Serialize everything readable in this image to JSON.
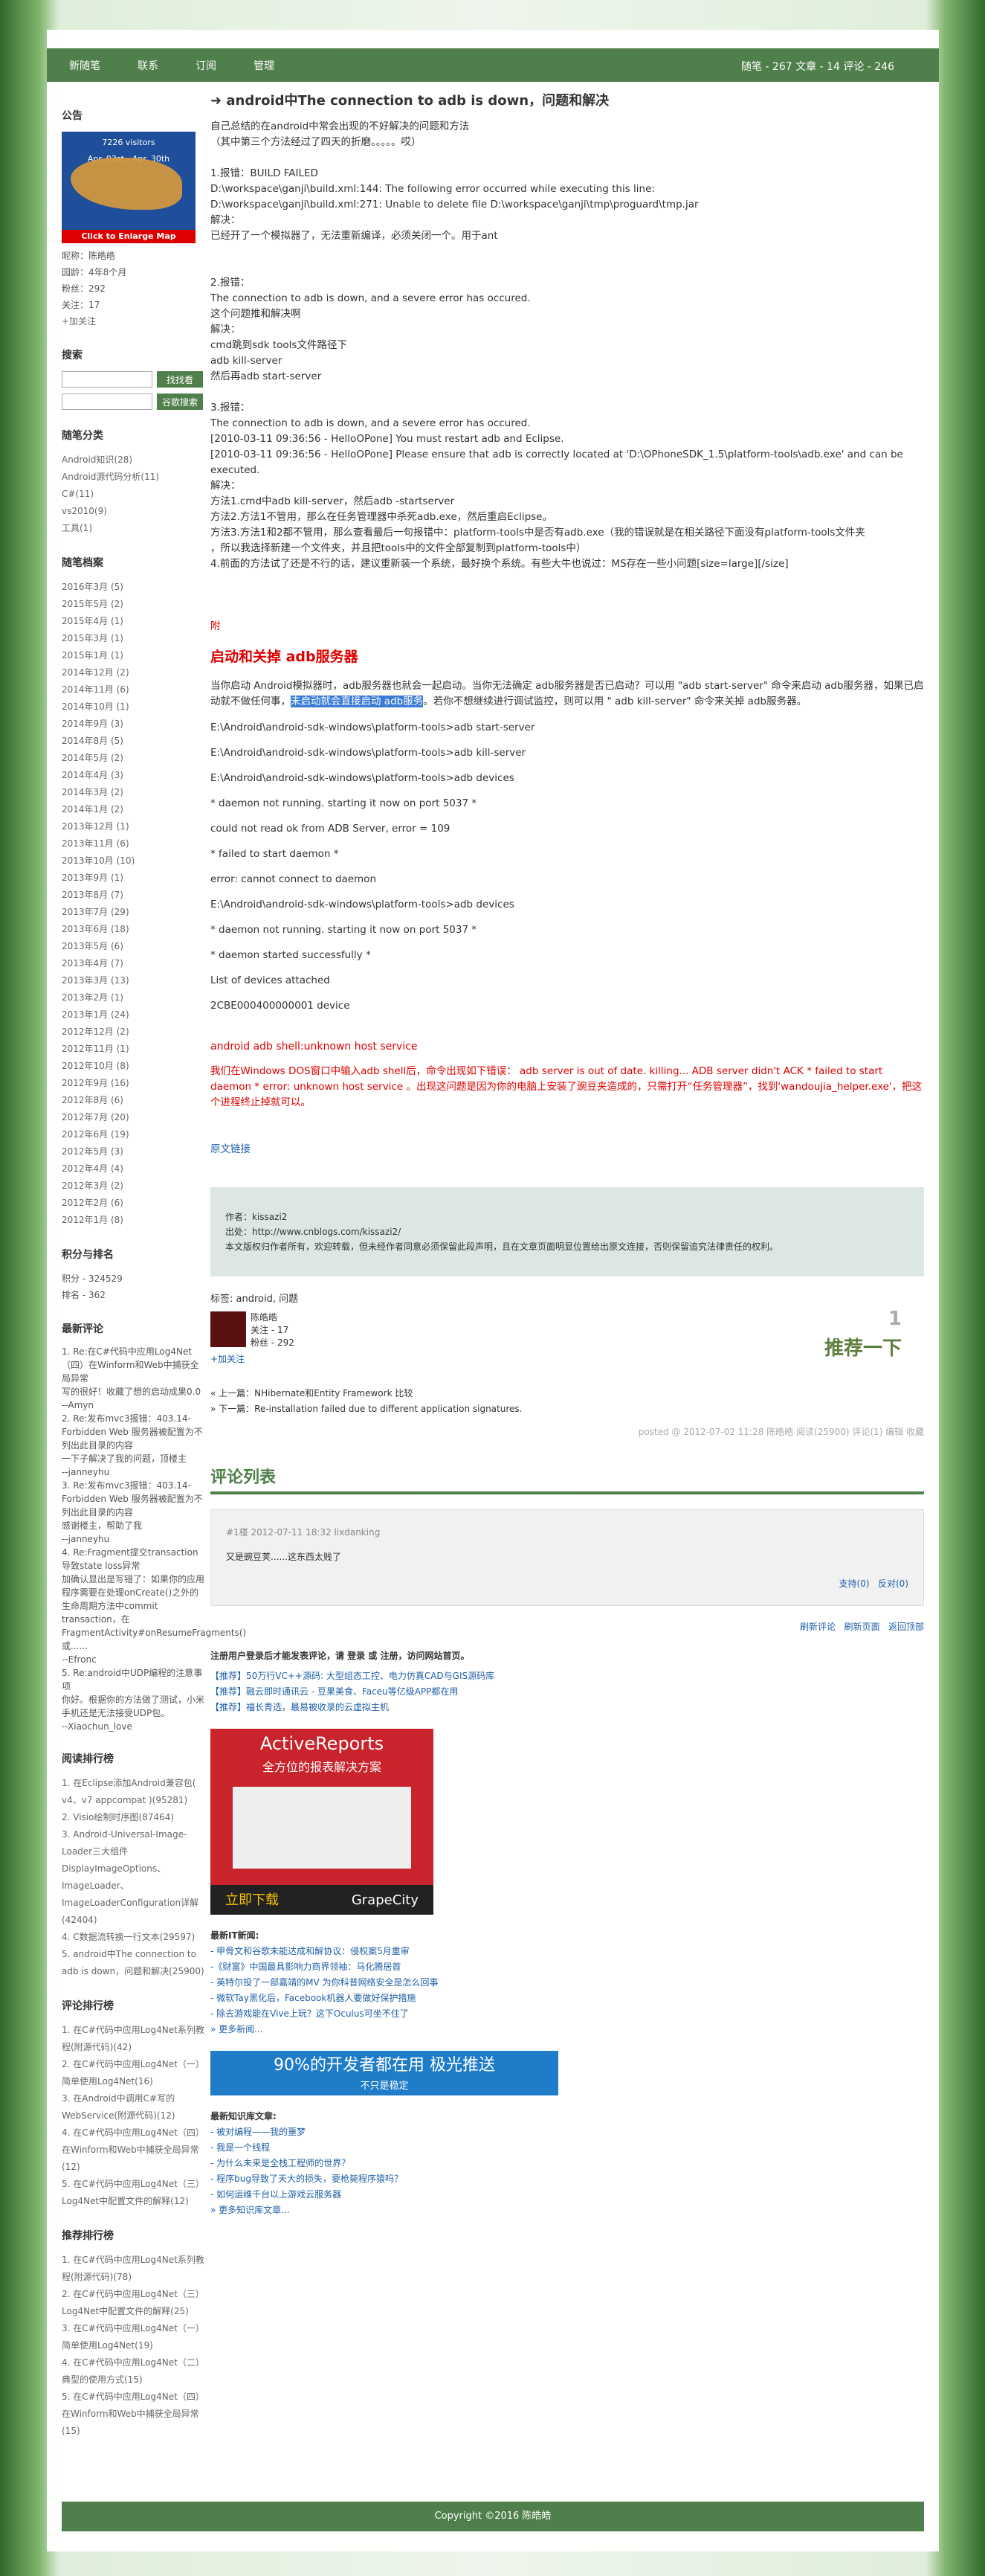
{
  "header": {
    "nav": [
      "新随笔",
      "联系",
      "订阅",
      "管理"
    ],
    "stats": "随笔 - 267  文章 - 14  评论 - 246"
  },
  "sidebar": {
    "notice_title": "公告",
    "map": {
      "caption1": "7226 visitors",
      "caption2": "Apr. 03st - Apr. 30th",
      "button": "Click to Enlarge Map"
    },
    "profile": [
      "昵称：陈皓皓",
      "园龄：4年8个月",
      "粉丝：292",
      "关注：17",
      "+加关注"
    ],
    "search_title": "搜索",
    "search_btn1": "找找看",
    "search_btn2": "谷歌搜索",
    "categories_title": "随笔分类",
    "categories": [
      "Android知识(28)",
      "Android源代码分析(11)",
      "C#(11)",
      "vs2010(9)",
      "工具(1)"
    ],
    "archive_title": "随笔档案",
    "archives": [
      "2016年3月 (5)",
      "2015年5月 (2)",
      "2015年4月 (1)",
      "2015年3月 (1)",
      "2015年1月 (1)",
      "2014年12月 (2)",
      "2014年11月 (6)",
      "2014年10月 (1)",
      "2014年9月 (3)",
      "2014年8月 (5)",
      "2014年5月 (2)",
      "2014年4月 (3)",
      "2014年3月 (2)",
      "2014年1月 (2)",
      "2013年12月 (1)",
      "2013年11月 (6)",
      "2013年10月 (10)",
      "2013年9月 (1)",
      "2013年8月 (7)",
      "2013年7月 (29)",
      "2013年6月 (18)",
      "2013年5月 (6)",
      "2013年4月 (7)",
      "2013年3月 (13)",
      "2013年2月 (1)",
      "2013年1月 (24)",
      "2012年12月 (2)",
      "2012年11月 (1)",
      "2012年10月 (8)",
      "2012年9月 (16)",
      "2012年8月 (6)",
      "2012年7月 (20)",
      "2012年6月 (19)",
      "2012年5月 (3)",
      "2012年4月 (4)",
      "2012年3月 (2)",
      "2012年2月 (6)",
      "2012年1月 (8)"
    ],
    "rank_title": "积分与排名",
    "rank": [
      "积分 - 324529",
      "排名 - 362"
    ],
    "latest_comments_title": "最新评论",
    "latest_comments": [
      "1. Re:在C#代码中应用Log4Net（四）在Winform和Web中捕获全局异常",
      "写的很好！收藏了想的启动成果0.0",
      "--Amyn",
      "2. Re:发布mvc3报错：403.14-Forbidden Web 服务器被配置为不列出此目录的内容",
      "一下子解决了我的问题，顶楼主",
      "--janneyhu",
      "3. Re:发布mvc3报错：403.14-Forbidden Web 服务器被配置为不列出此目录的内容",
      "感谢楼主，帮助了我",
      "--janneyhu",
      "4. Re:Fragment提交transaction导致state loss异常",
      "加确认显出是写错了：如果你的应用程序需要在处理onCreate()之外的生命周期方法中commit transaction，在FragmentActivity#onResumeFragments() 或......",
      "--Efronc",
      "5. Re:android中UDP编程的注意事项",
      "你好。根据你的方法做了测试，小米手机还是无法接受UDP包。",
      "--Xiaochun_love"
    ],
    "read_rank_title": "阅读排行榜",
    "read_rank": [
      "1. 在Eclipse添加Android兼容包( v4、v7 appcompat )(95281)",
      "2. Visio绘制时序图(87464)",
      "3. Android-Universal-Image-Loader三大组件DisplayImageOptions、ImageLoader、ImageLoaderConfiguration详解(42404)",
      "4. C数据流转换一行文本(29597)",
      "5. android中The connection to adb is down，问题和解决(25900)"
    ],
    "comment_rank_title": "评论排行榜",
    "comment_rank": [
      "1. 在C#代码中应用Log4Net系列教程(附源代码)(42)",
      "2. 在C#代码中应用Log4Net（一）简单使用Log4Net(16)",
      "3. 在Android中调用C#写的WebService(附源代码)(12)",
      "4. 在C#代码中应用Log4Net（四）在Winform和Web中捕获全局异常(12)",
      "5. 在C#代码中应用Log4Net（三）Log4Net中配置文件的解释(12)"
    ],
    "recommend_rank_title": "推荐排行榜",
    "recommend_rank": [
      "1. 在C#代码中应用Log4Net系列教程(附源代码)(78)",
      "2. 在C#代码中应用Log4Net（三）Log4Net中配置文件的解释(25)",
      "3. 在C#代码中应用Log4Net（一）简单使用Log4Net(19)",
      "4. 在C#代码中应用Log4Net（二）典型的使用方式(15)",
      "5. 在C#代码中应用Log4Net（四）在Winform和Web中捕获全局异常(15)"
    ]
  },
  "post": {
    "title": "android中The connection to adb is down，问题和解决",
    "intro": [
      "自己总结的在android中常会出现的不好解决的问题和方法",
      "（其中第三个方法经过了四天的折磨。。。。。哎）"
    ],
    "block1": [
      "1.报错：BUILD FAILED",
      "D:\\workspace\\ganji\\build.xml:144: The following error occurred while executing this line:",
      "D:\\workspace\\ganji\\build.xml:271: Unable to delete file D:\\workspace\\ganji\\tmp\\proguard\\tmp.jar",
      "解决：",
      "已经开了一个模拟器了，无法重新编译，必须关闭一个。用于ant"
    ],
    "block2": [
      "2.报错：",
      "The connection to adb is down, and a severe error has occured.",
      "这个问题推和解决啊",
      "解决：",
      "cmd跳到sdk tools文件路径下",
      "adb kill-server",
      "然后再adb start-server"
    ],
    "block3": [
      "3.报错：",
      "The connection to adb is down, and a severe error has occured.",
      "[2010-03-11 09:36:56 - HelloOPone] You must restart adb and Eclipse.",
      "[2010-03-11 09:36:56 - HelloOPone] Please ensure that adb is correctly located at 'D:\\OPhoneSDK_1.5\\platform-tools\\adb.exe' and can be executed.",
      "解决：",
      "方法1.cmd中adb kill-server，然后adb -startserver",
      "方法2.方法1不管用，那么在任务管理器中杀死adb.exe，然后重启Eclipse。",
      "方法3.方法1和2都不管用，那么查看最后一句报错中：platform-tools中是否有adb.exe（我的错误就是在相关路径下面没有platform-tools文件夹",
      "    ，所以我选择新建一个文件夹，并且把tools中的文件全部复制到platform-tools中）",
      "4.前面的方法试了还是不行的话，建议重新装一个系统，最好换个系统。有些大牛也说过：MS存在一些小问题[size=large][/size]"
    ],
    "fu": "附",
    "section_title": "启动和关掉 adb服务器",
    "para_a": "当你启动 Android模拟器时，adb服务器也就会一起启动。当你无法确定 adb服务器是否已启动？可以用 \"adb start-server\" 命令来启动 adb服务器，如果已启动就不做任何事，",
    "para_highlight": "未启动就会直接启动 adb服务",
    "para_b": "。若你不想继续进行调试监控，则可以用 \" adb kill-server\" 命令来关掉 adb服务器。",
    "commands": [
      "E:\\Android\\android-sdk-windows\\platform-tools>adb start-server",
      "E:\\Android\\android-sdk-windows\\platform-tools>adb kill-server",
      "E:\\Android\\android-sdk-windows\\platform-tools>adb devices",
      "* daemon not running. starting it now on port 5037 *",
      "could not read ok from ADB Server, error = 109",
      "* failed to start daemon *",
      "error: cannot connect to daemon",
      "E:\\Android\\android-sdk-windows\\platform-tools>adb devices",
      "* daemon not running. starting it now on port 5037 *",
      "* daemon started successfully *",
      "List of devices attached",
      "2CBE000400000001        device"
    ],
    "red_title": "android adb shell:unknown host service",
    "red_text": "我们在Windows DOS窗口中输入adb shell后，命令出现如下错误： adb server is out of date.  killing... ADB server didn't ACK * failed to start daemon * error: unknown host service   。出现这问题是因为你的电脑上安装了豌豆夹造成的，只需打开“任务管理器”，找到'wandoujia_helper.exe'，把这个进程终止掉就可以。",
    "orig_link": "原文链接",
    "notebox": [
      "作者：kissazi2",
      "出处：http://www.cnblogs.com/kissazi2/",
      "本文版权归作者所有，欢迎转载，但未经作者同意必须保留此段声明，且在文章页面明显位置给出原文连接，否则保留追究法律责任的权利。"
    ],
    "tags_label": "标签: android, 问题",
    "author_name": "陈皓皓",
    "author_follow": "关注 - 17",
    "author_fans": "粉丝 - 292",
    "add_follow": "+加关注",
    "rec_count": "1",
    "rec_text": "推荐一下",
    "prev": "« 上一篇：NHibernate和Entity Framework 比较",
    "next": "» 下一篇：Re-installation failed due to different application signatures.",
    "posted": "posted @ 2012-07-02 11:28 陈皓皓 阅读(25900) 评论(1) 编辑 收藏"
  },
  "comments": {
    "title": "评论列表",
    "header": "#1楼 2012-07-11 18:32 lixdanking",
    "body": "又是豌豆荚......这东西太贱了",
    "support": "支持(0)",
    "oppose": "反对(0)",
    "refresh": "刷新评论",
    "refresh_page": "刷新页面",
    "back_top": "返回顶部"
  },
  "bottom": {
    "login_note": "注册用户登录后才能发表评论，请 登录 或 注册，访问网站首页。",
    "promos": [
      "【推荐】50万行VC++源码: 大型组态工控、电力仿真CAD与GIS源码库",
      "【推荐】融云即时通讯云 - 豆果美食、Faceu等亿级APP都在用",
      "【推荐】福长青选，最易被收录的云虚拟主机"
    ],
    "ad_title": "ActiveReports",
    "ad_sub": "全方位的报表解决方案",
    "ad_cta": "立即下载",
    "ad_brand": "GrapeCity",
    "news_title": "最新IT新闻:",
    "news": [
      "- 甲骨文和谷歌未能达成和解协议：侵权案5月重审",
      "-《财富》中国最具影响力商界领袖：马化腾居首",
      "- 英特尔投了一部嘉靖的MV 为你科普网络安全是怎么回事",
      "- 微软Tay黑化后，Facebook机器人要做好保护措施",
      "- 除去游戏能在Vive上玩？这下Oculus可坐不住了",
      "» 更多新闻..."
    ],
    "bar_ad": "90%的开发者都在用 极光推送",
    "bar_ad_sub": "不只是稳定",
    "kb_title": "最新知识库文章:",
    "kb": [
      "- 被对编程——我的噩梦",
      "- 我是一个线程",
      "- 为什么未来是全栈工程师的世界？",
      "- 程序bug导致了天大的损失，要枪毙程序猿吗？",
      "- 如何运维千台以上游戏云服务器",
      "» 更多知识库文章..."
    ]
  },
  "footer": "Copyright ©2016 陈皓皓"
}
